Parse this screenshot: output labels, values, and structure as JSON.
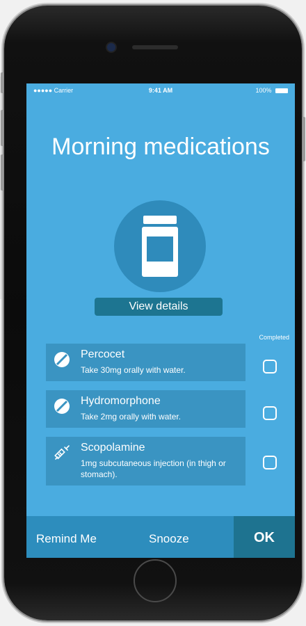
{
  "status_bar": {
    "carrier": "●●●●● Carrier",
    "time": "9:41 AM",
    "battery": "100%"
  },
  "title": "Morning medications",
  "view_details_label": "View details",
  "completed_label": "Completed",
  "medications": [
    {
      "name": "Percocet",
      "instructions": "Take 30mg orally with water.",
      "icon": "pill-icon",
      "completed": false
    },
    {
      "name": "Hydromorphone",
      "instructions": "Take 2mg orally with water.",
      "icon": "pill-icon",
      "completed": false
    },
    {
      "name": "Scopolamine",
      "instructions": "1mg subcutaneous injection (in thigh or stomach).",
      "icon": "syringe-icon",
      "completed": false
    }
  ],
  "actions": {
    "remind": "Remind Me",
    "snooze": "Snooze",
    "ok": "OK"
  },
  "colors": {
    "screen_bg": "#4aace0",
    "card_bg": "#3a94c2",
    "accent": "#1e7390"
  }
}
